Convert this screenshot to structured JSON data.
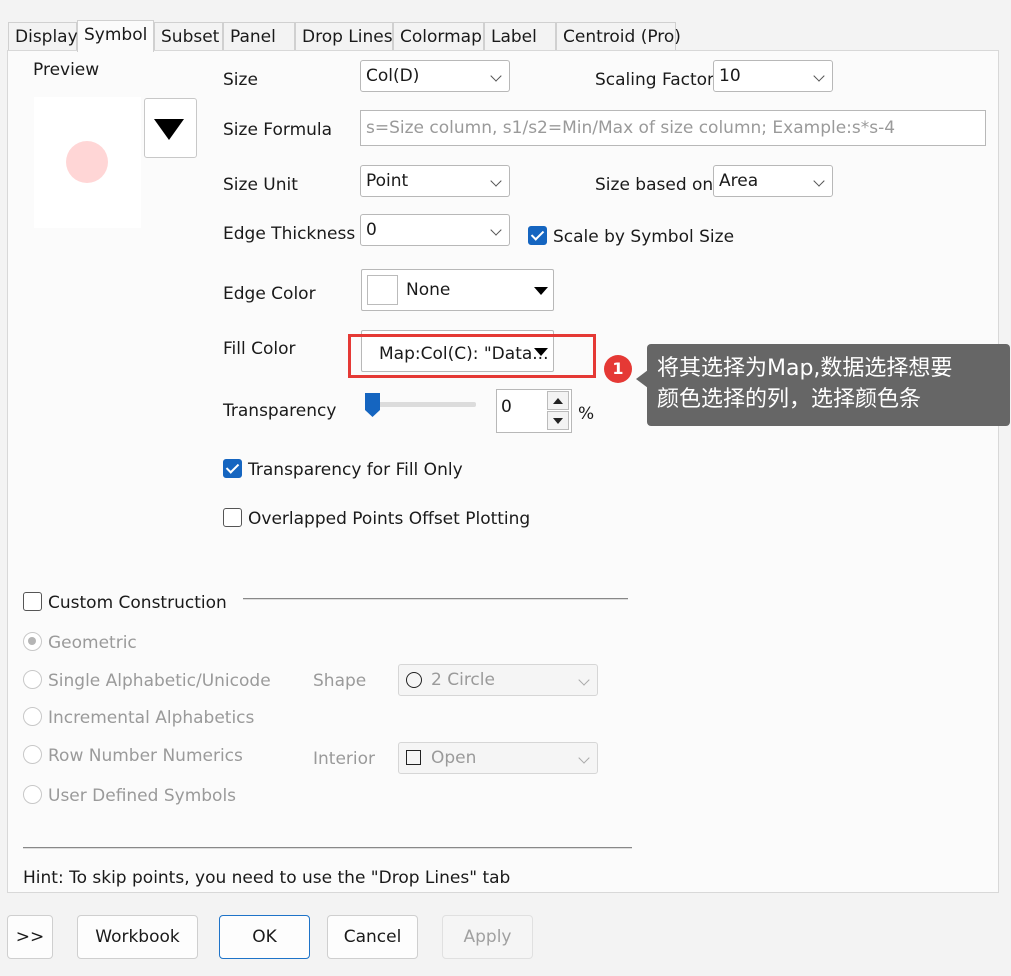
{
  "tabs": [
    "Display",
    "Symbol",
    "Subset",
    "Panel",
    "Drop Lines",
    "Colormap",
    "Label",
    "Centroid (Pro)"
  ],
  "preview": {
    "label": "Preview",
    "marker_color": "#ffd6d6"
  },
  "size": {
    "label": "Size",
    "value": "Col(D)"
  },
  "scaling_factor": {
    "label": "Scaling Factor",
    "value": "10"
  },
  "size_formula": {
    "label": "Size Formula",
    "placeholder": "s=Size column, s1/s2=Min/Max of size column; Example:s*s-4"
  },
  "size_unit": {
    "label": "Size Unit",
    "value": "Point"
  },
  "size_based_on": {
    "label": "Size based on",
    "value": "Area"
  },
  "edge_thickness": {
    "label": "Edge Thickness",
    "value": "0"
  },
  "scale_by_symbol_size": {
    "label": "Scale by Symbol Size",
    "checked": true
  },
  "edge_color": {
    "label": "Edge Color",
    "value": "None"
  },
  "fill_color": {
    "label": "Fill Color",
    "value": "Map:Col(C): \"Data..."
  },
  "transparency": {
    "label": "Transparency",
    "value": "0",
    "unit": "%",
    "level": 0
  },
  "transparency_fill_only": {
    "label": "Transparency for Fill Only",
    "checked": true
  },
  "overlapped_offset": {
    "label": "Overlapped Points Offset Plotting",
    "checked": false
  },
  "custom_construction": {
    "label": "Custom Construction",
    "checked": false
  },
  "construction_options": [
    "Geometric",
    "Single Alphabetic/Unicode",
    "Incremental Alphabetics",
    "Row Number Numerics",
    "User Defined Symbols"
  ],
  "shape": {
    "label": "Shape",
    "value": "2 Circle"
  },
  "interior": {
    "label": "Interior",
    "value": "Open"
  },
  "hint": "Hint: To skip points, you need to use the \"Drop Lines\" tab",
  "buttons": {
    "expand": ">>",
    "workbook": "Workbook",
    "ok": "OK",
    "cancel": "Cancel",
    "apply": "Apply"
  },
  "annotation": {
    "number": "1",
    "text_line1": "将其选择为Map,数据选择想要",
    "text_line2": "颜色选择的列，选择颜色条",
    "highlight_color": "#e53935",
    "tooltip_bg": "#666666"
  }
}
